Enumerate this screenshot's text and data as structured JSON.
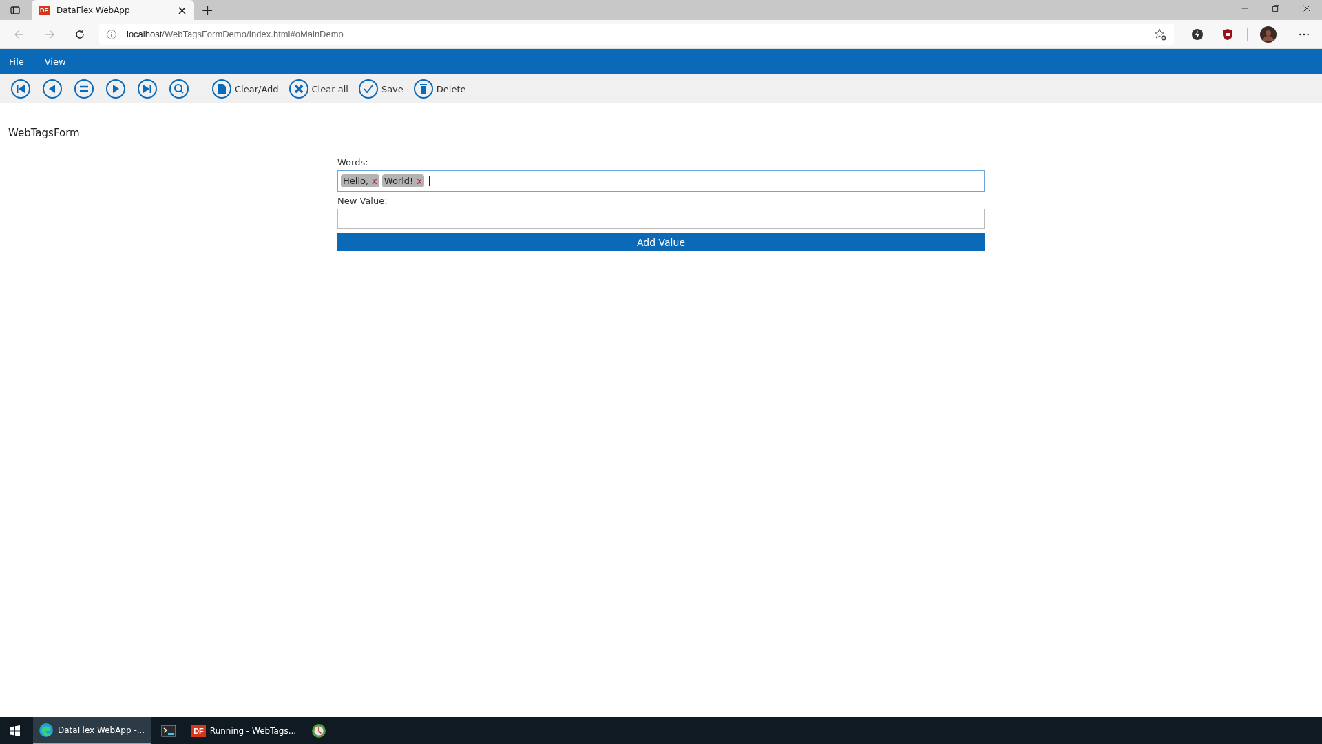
{
  "browser": {
    "tab": {
      "icon_text": "DF",
      "title": "DataFlex WebApp",
      "close": "×"
    },
    "new_tab": "+",
    "url_host": "localhost",
    "url_path": "/WebTagsFormDemo/Index.html#oMainDemo"
  },
  "menu": [
    {
      "label": "File"
    },
    {
      "label": "View"
    }
  ],
  "toolbar": {
    "nav": [
      {
        "kind": "first"
      },
      {
        "kind": "prev"
      },
      {
        "kind": "list"
      },
      {
        "kind": "next"
      },
      {
        "kind": "last"
      },
      {
        "kind": "search"
      }
    ],
    "actions": [
      {
        "kind": "new",
        "label": "Clear/Add"
      },
      {
        "kind": "clear",
        "label": "Clear all"
      },
      {
        "kind": "save",
        "label": "Save"
      },
      {
        "kind": "delete",
        "label": "Delete"
      }
    ]
  },
  "page_title": "WebTagsForm",
  "form": {
    "words_label": "Words:",
    "tags": [
      {
        "label": "Hello,",
        "remove": "x"
      },
      {
        "label": "World!",
        "remove": "x"
      }
    ],
    "new_value_label": "New Value:",
    "add_button": "Add Value"
  },
  "taskbar": [
    {
      "kind": "edge",
      "label": "DataFlex WebApp -...",
      "selected": true
    },
    {
      "kind": "terminal",
      "selected": false
    },
    {
      "kind": "df",
      "icon_text": "DF",
      "label": "Running - WebTags...",
      "selected": false
    },
    {
      "kind": "globe",
      "selected": false
    }
  ]
}
